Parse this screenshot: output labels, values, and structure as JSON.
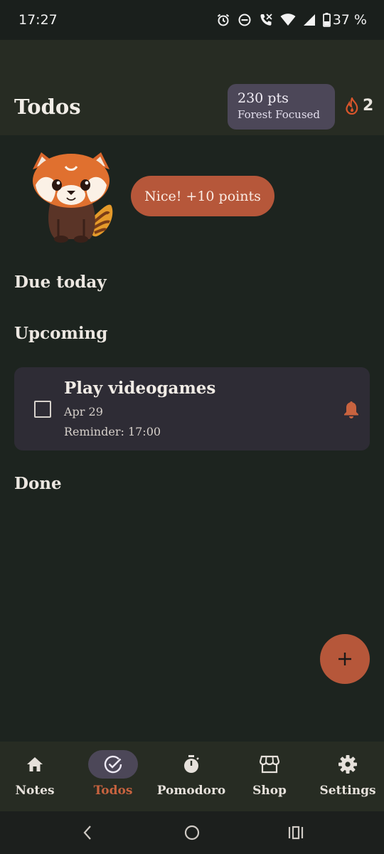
{
  "status_bar": {
    "time": "17:27",
    "battery": "37 %",
    "icons": [
      "alarm-icon",
      "do-not-disturb-icon",
      "wifi-calling-icon",
      "wifi-icon",
      "signal-icon",
      "battery-icon"
    ]
  },
  "header": {
    "title": "Todos",
    "points": "230 pts",
    "rank": "Forest Focused",
    "streak": "2",
    "streak_icon": "flame-icon"
  },
  "mascot": {
    "icon": "red-panda-mascot"
  },
  "toast": {
    "text": "Nice! +10 points"
  },
  "sections": {
    "due_today": "Due today",
    "upcoming": "Upcoming",
    "done": "Done"
  },
  "todos": [
    {
      "title": "Play videogames",
      "date": "Apr 29",
      "reminder": "Reminder: 17:00",
      "checked": false,
      "icon": "bell-icon"
    }
  ],
  "fab": {
    "icon": "plus-icon"
  },
  "bottom_nav": {
    "items": [
      {
        "label": "Notes",
        "icon": "home-icon",
        "active": false
      },
      {
        "label": "Todos",
        "icon": "check-circle-icon",
        "active": true
      },
      {
        "label": "Pomodoro",
        "icon": "stopwatch-icon",
        "active": false
      },
      {
        "label": "Shop",
        "icon": "storefront-icon",
        "active": false
      },
      {
        "label": "Settings",
        "icon": "gear-icon",
        "active": false
      }
    ]
  },
  "colors": {
    "background": "#1d241f",
    "header": "#272c23",
    "accent": "#b6573a",
    "chip": "#4c4758",
    "card": "#2e2c35"
  }
}
